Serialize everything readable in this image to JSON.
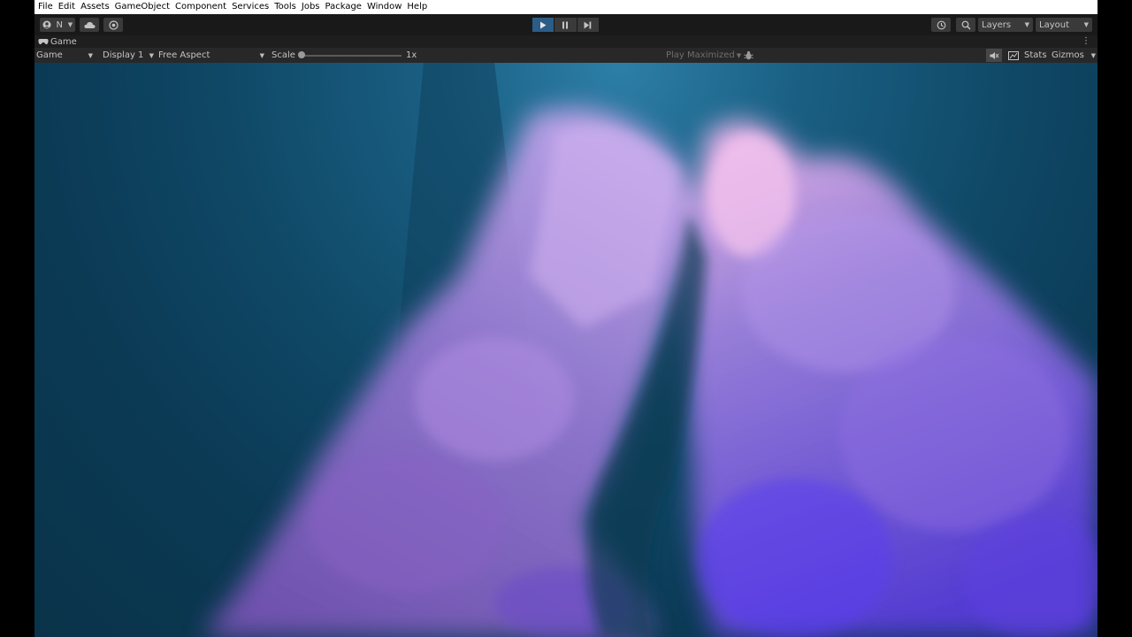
{
  "menu": [
    "File",
    "Edit",
    "Assets",
    "GameObject",
    "Component",
    "Services",
    "Tools",
    "Jobs",
    "Package",
    "Window",
    "Help"
  ],
  "toolbar": {
    "account_label": "N",
    "layers_label": "Layers",
    "layout_label": "Layout"
  },
  "tab": {
    "label": "Game"
  },
  "controls": {
    "view_mode": "Game",
    "display": "Display 1",
    "aspect": "Free Aspect",
    "scale_label": "Scale",
    "scale_value": "1x",
    "play_mode": "Play Maximized",
    "stats": "Stats",
    "gizmos": "Gizmos"
  },
  "colors": {
    "play_active": "#2c5d87",
    "cloud_violet": "#a67ae0",
    "water": "#0f4866"
  },
  "icons": [
    "account-icon",
    "cloud-icon",
    "collab-icon",
    "play-icon",
    "pause-icon",
    "step-icon",
    "history-icon",
    "search-icon",
    "game-tab-icon",
    "kebab-icon",
    "bug-icon",
    "mute-icon",
    "stats-icon"
  ]
}
